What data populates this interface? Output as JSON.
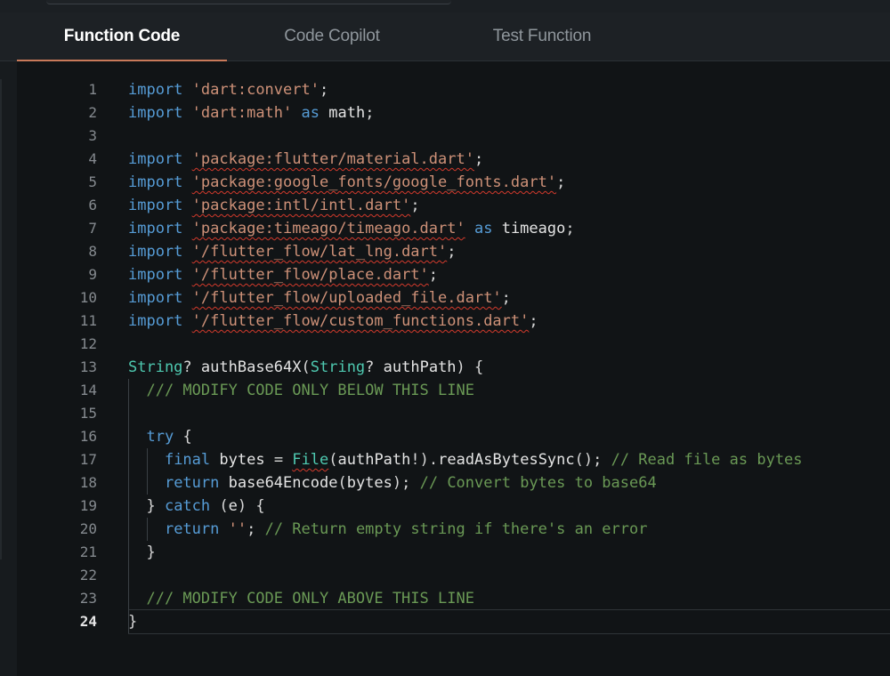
{
  "tabs": [
    {
      "label": "Function Code",
      "active": true
    },
    {
      "label": "Code Copilot",
      "active": false
    },
    {
      "label": "Test Function",
      "active": false
    }
  ],
  "editor": {
    "current_line": 24,
    "lines": [
      {
        "n": "1",
        "tokens": [
          [
            "kw",
            "import"
          ],
          [
            "",
            "",
            " "
          ],
          [
            "str",
            "'dart:convert'"
          ],
          [
            "",
            ";"
          ]
        ]
      },
      {
        "n": "2",
        "tokens": [
          [
            "kw",
            "import"
          ],
          [
            "",
            " "
          ],
          [
            "str",
            "'dart:math'"
          ],
          [
            "",
            " "
          ],
          [
            "kw",
            "as"
          ],
          [
            "",
            " "
          ],
          [
            "id",
            "math"
          ],
          [
            "",
            ";"
          ]
        ]
      },
      {
        "n": "3",
        "tokens": []
      },
      {
        "n": "4",
        "tokens": [
          [
            "kw",
            "import"
          ],
          [
            "",
            " "
          ],
          [
            "str squig",
            "'package:flutter/material.dart'"
          ],
          [
            "",
            ";"
          ]
        ]
      },
      {
        "n": "5",
        "tokens": [
          [
            "kw",
            "import"
          ],
          [
            "",
            " "
          ],
          [
            "str squig",
            "'package:google_fonts/google_fonts.dart'"
          ],
          [
            "",
            ";"
          ]
        ]
      },
      {
        "n": "6",
        "tokens": [
          [
            "kw",
            "import"
          ],
          [
            "",
            " "
          ],
          [
            "str squig",
            "'package:intl/intl.dart'"
          ],
          [
            "",
            ";"
          ]
        ]
      },
      {
        "n": "7",
        "tokens": [
          [
            "kw",
            "import"
          ],
          [
            "",
            " "
          ],
          [
            "str squig",
            "'package:timeago/timeago.dart'"
          ],
          [
            "",
            " "
          ],
          [
            "kw",
            "as"
          ],
          [
            "",
            " "
          ],
          [
            "id",
            "timeago"
          ],
          [
            "",
            ";"
          ]
        ]
      },
      {
        "n": "8",
        "tokens": [
          [
            "kw",
            "import"
          ],
          [
            "",
            " "
          ],
          [
            "str squig",
            "'/flutter_flow/lat_lng.dart'"
          ],
          [
            "",
            ";"
          ]
        ]
      },
      {
        "n": "9",
        "tokens": [
          [
            "kw",
            "import"
          ],
          [
            "",
            " "
          ],
          [
            "str squig",
            "'/flutter_flow/place.dart'"
          ],
          [
            "",
            ";"
          ]
        ]
      },
      {
        "n": "10",
        "tokens": [
          [
            "kw",
            "import"
          ],
          [
            "",
            " "
          ],
          [
            "str squig",
            "'/flutter_flow/uploaded_file.dart'"
          ],
          [
            "",
            ";"
          ]
        ]
      },
      {
        "n": "11",
        "tokens": [
          [
            "kw",
            "import"
          ],
          [
            "",
            " "
          ],
          [
            "str squig",
            "'/flutter_flow/custom_functions.dart'"
          ],
          [
            "",
            ";"
          ]
        ]
      },
      {
        "n": "12",
        "tokens": []
      },
      {
        "n": "13",
        "tokens": [
          [
            "ty",
            "String"
          ],
          [
            "",
            "? "
          ],
          [
            "id",
            "authBase64X"
          ],
          [
            "",
            "("
          ],
          [
            "ty",
            "String"
          ],
          [
            "",
            "? "
          ],
          [
            "id",
            "authPath"
          ],
          [
            "",
            ") {"
          ]
        ]
      },
      {
        "n": "14",
        "tokens": [
          [
            "",
            "  "
          ],
          [
            "cm",
            "/// MODIFY CODE ONLY BELOW THIS LINE"
          ]
        ]
      },
      {
        "n": "15",
        "tokens": []
      },
      {
        "n": "16",
        "tokens": [
          [
            "",
            "  "
          ],
          [
            "kw",
            "try"
          ],
          [
            "",
            " {"
          ]
        ]
      },
      {
        "n": "17",
        "tokens": [
          [
            "",
            "    "
          ],
          [
            "kw",
            "final"
          ],
          [
            "",
            " "
          ],
          [
            "id",
            "bytes"
          ],
          [
            "",
            " = "
          ],
          [
            "ty squig",
            "File"
          ],
          [
            "",
            "("
          ],
          [
            "id",
            "authPath"
          ],
          [
            "",
            "!)."
          ],
          [
            "id",
            "readAsBytesSync"
          ],
          [
            "",
            "(); "
          ],
          [
            "cm",
            "// Read file as bytes"
          ]
        ]
      },
      {
        "n": "18",
        "tokens": [
          [
            "",
            "    "
          ],
          [
            "kw",
            "return"
          ],
          [
            "",
            " "
          ],
          [
            "id",
            "base64Encode"
          ],
          [
            "",
            "("
          ],
          [
            "id",
            "bytes"
          ],
          [
            "",
            "); "
          ],
          [
            "cm",
            "// Convert bytes to base64"
          ]
        ]
      },
      {
        "n": "19",
        "tokens": [
          [
            "",
            "  } "
          ],
          [
            "kw",
            "catch"
          ],
          [
            "",
            " ("
          ],
          [
            "id",
            "e"
          ],
          [
            "",
            ") {"
          ]
        ]
      },
      {
        "n": "20",
        "tokens": [
          [
            "",
            "    "
          ],
          [
            "kw",
            "return"
          ],
          [
            "",
            " "
          ],
          [
            "str",
            "''"
          ],
          [
            "",
            "; "
          ],
          [
            "cm",
            "// Return empty string if there's an error"
          ]
        ]
      },
      {
        "n": "21",
        "tokens": [
          [
            "",
            "  }"
          ]
        ]
      },
      {
        "n": "22",
        "tokens": []
      },
      {
        "n": "23",
        "tokens": [
          [
            "",
            "  "
          ],
          [
            "cm",
            "/// MODIFY CODE ONLY ABOVE THIS LINE"
          ]
        ]
      },
      {
        "n": "24",
        "tokens": [
          [
            "",
            "}"
          ]
        ]
      }
    ]
  }
}
